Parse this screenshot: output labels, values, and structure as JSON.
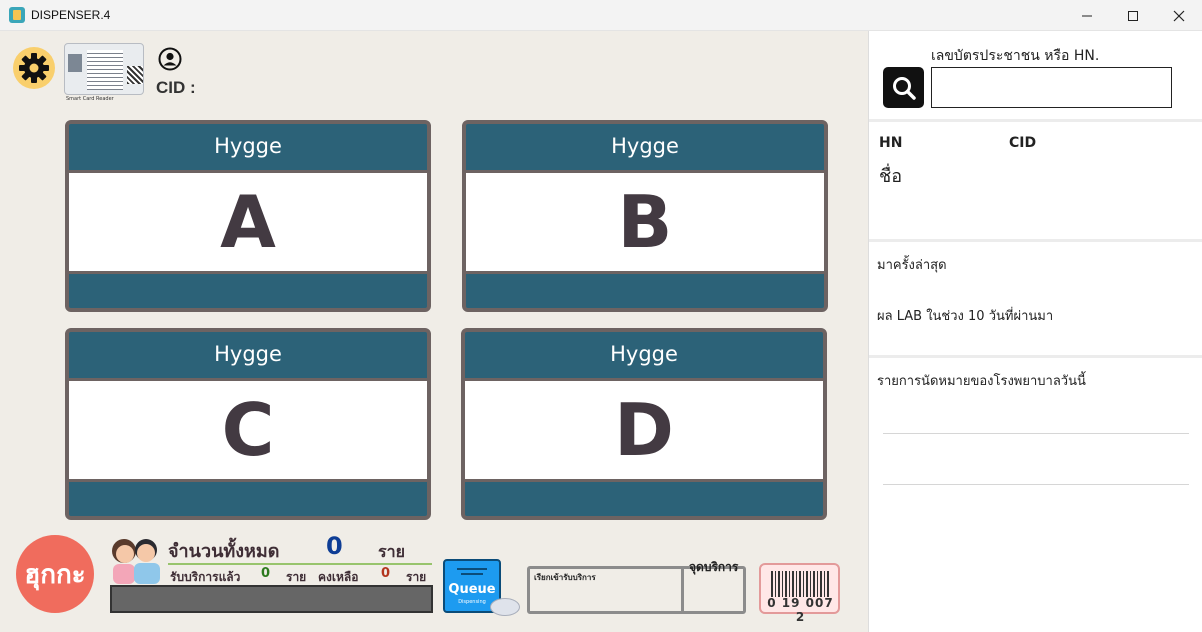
{
  "window": {
    "title": "DISPENSER.4",
    "min_icon": "minimize-icon",
    "max_icon": "maximize-icon",
    "close_icon": "close-icon"
  },
  "header": {
    "reader_label": "Smart Card Reader",
    "cid_label": "CID :"
  },
  "queues": [
    {
      "title": "Hygge",
      "letter": "A"
    },
    {
      "title": "Hygge",
      "letter": "B"
    },
    {
      "title": "Hygge",
      "letter": "C"
    },
    {
      "title": "Hygge",
      "letter": "D"
    }
  ],
  "footer": {
    "logo_text": "ฮุกกะ",
    "total_label": "จำนวนทั้งหมด",
    "total_value": "0",
    "total_unit": "ราย",
    "served_label": "รับบริการแล้ว",
    "served_value": "0",
    "served_unit": "ราย",
    "remaining_label": "คงเหลือ",
    "remaining_value": "0",
    "remaining_unit": "ราย",
    "queue_label": "Queue",
    "queue_sub": "Dispensing",
    "call_label": "เรียกเข้ารับบริการ",
    "service_point_label": "จุดบริการ",
    "barcode_digits": "0 19 007 2"
  },
  "right_panel": {
    "search_label": "เลขบัตรประชาชน หรือ HN.",
    "search_value": "",
    "hn_label": "HN",
    "cid_label": "CID",
    "name_label": "ชื่อ",
    "last_visit_label": "มาครั้งล่าสุด",
    "lab_label": "ผล LAB ในช่วง 10 วันที่ผ่านมา",
    "appointments_label": "รายการนัดหมายของโรงพยาบาลวันนี้"
  },
  "colors": {
    "queue_header": "#2c6278",
    "queue_border": "#6d6362",
    "letter": "#433a42",
    "total_value": "#0e3d95",
    "logo": "#f06c5d"
  }
}
